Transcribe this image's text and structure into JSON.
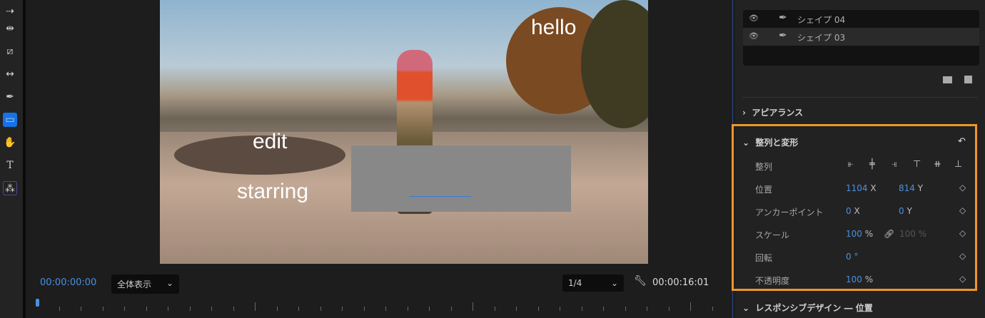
{
  "toolbar": {
    "tools": [
      "track-select-forward",
      "ripple-edit",
      "razor",
      "slip",
      "pen",
      "rectangle",
      "hand",
      "type",
      "remix"
    ],
    "active": "rectangle"
  },
  "overlay_texts": {
    "hello": "hello",
    "edit": "edit",
    "starring": "starring"
  },
  "monitor": {
    "current_timecode": "00:00:00:00",
    "zoom_select": "全体表示",
    "resolution_select": "1/4",
    "duration_timecode": "00:00:16:01"
  },
  "panel": {
    "layers": [
      {
        "name": "シェイプ 04"
      },
      {
        "name": "シェイプ 03"
      }
    ],
    "appearance_label": "アピアランス",
    "transform": {
      "title": "整列と変形",
      "align_label": "整列",
      "position": {
        "label": "位置",
        "x": "1104",
        "x_unit": "X",
        "y": "814",
        "y_unit": "Y"
      },
      "anchor": {
        "label": "アンカーポイント",
        "x": "0",
        "x_unit": "X",
        "y": "0",
        "y_unit": "Y"
      },
      "scale": {
        "label": "スケール",
        "value": "100",
        "unit": "%",
        "linked_value": "100 %"
      },
      "rotation": {
        "label": "回転",
        "value": "0",
        "unit": "°"
      },
      "opacity": {
        "label": "不透明度",
        "value": "100",
        "unit": "%"
      }
    },
    "responsive_label": "レスポンシブデザイン ― 位置"
  },
  "colors": {
    "accent": "#1473e6",
    "highlight": "#f0962a",
    "value_blue": "#4a90e2"
  }
}
